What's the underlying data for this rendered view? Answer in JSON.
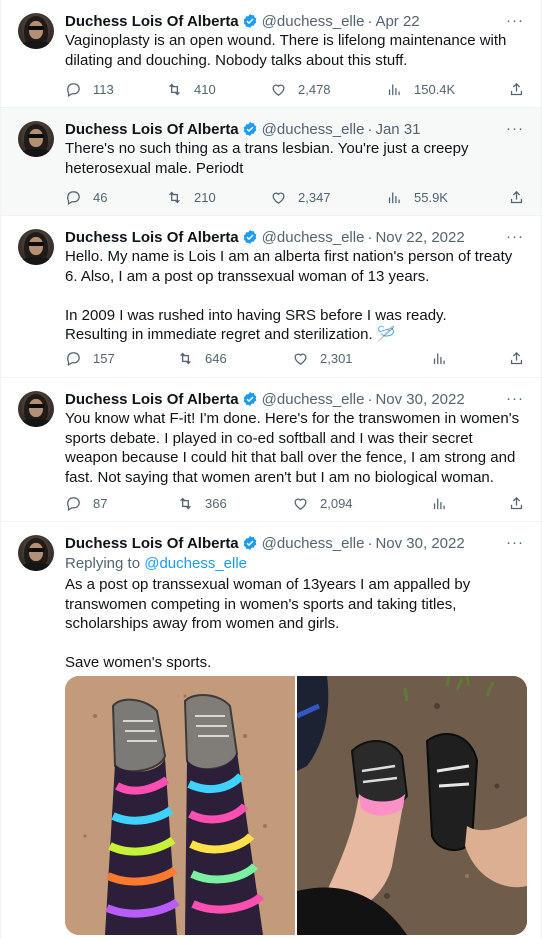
{
  "author": {
    "name": "Duchess Lois Of Alberta",
    "handle": "@duchess_elle",
    "verified_color": "#1d9bf0"
  },
  "colors": {
    "accent": "#1d9bf0",
    "muted": "#536471",
    "text": "#0f1419"
  },
  "more_glyph": "···",
  "separator": "·",
  "tweets": [
    {
      "date": "Apr 22",
      "text": "Vaginoplasty is an open wound. There is lifelong maintenance with dilating and douching. Nobody talks about this stuff.",
      "replies": "113",
      "retweets": "410",
      "likes": "2,478",
      "views": "150.4K"
    },
    {
      "date": "Jan 31",
      "text": "There's no such thing as a trans lesbian. You're just a creepy heterosexual male. Periodt",
      "replies": "46",
      "retweets": "210",
      "likes": "2,347",
      "views": "55.9K"
    },
    {
      "date": "Nov 22, 2022",
      "text": "Hello. My name is Lois I am an alberta first nation's person of treaty 6. Also, I am a post op transsexual woman of 13 years.\n\nIn 2009 I was rushed into having SRS before I was ready.\nResulting in immediate regret and sterilization. 🪡",
      "replies": "157",
      "retweets": "646",
      "likes": "2,301",
      "views": ""
    },
    {
      "date": "Nov 30, 2022",
      "text": "You know what F-it! I'm done. Here's for the transwomen in women's sports debate. I played in co-ed softball and I was their secret weapon because I could hit that ball over the fence, I am strong and fast. Not saying that women aren't but I am no biological woman.",
      "replies": "87",
      "retweets": "366",
      "likes": "2,094",
      "views": ""
    },
    {
      "date": "Nov 30, 2022",
      "replying_label": "Replying to",
      "replying_handle": "@duchess_elle",
      "text": "As a post op transsexual woman of 13years I am appalled by transwomen competing in women's sports and taking titles, scholarships away from women and girls.\n\nSave women's sports."
    }
  ]
}
